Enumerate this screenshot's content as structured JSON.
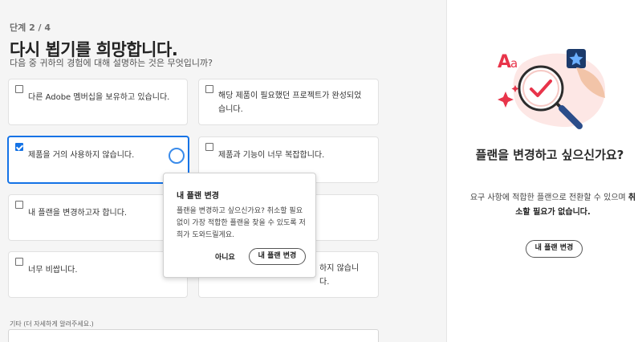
{
  "step": "단계 2 / 4",
  "title": "다시 뵙기를 희망합니다.",
  "subtitle": "다음 중 귀하의 경험에 대해 설명하는 것은 무엇입니까?",
  "options": [
    {
      "label": "다른 Adobe 멤버십을 보유하고 있습니다.",
      "checked": false
    },
    {
      "label": "해당 제품이 필요했던 프로젝트가 완성되었습니다.",
      "checked": false
    },
    {
      "label": "제품을 거의 사용하지 않습니다.",
      "checked": true
    },
    {
      "label": "제품과 기능이 너무 복잡합니다.",
      "checked": false
    },
    {
      "label": "내 플랜을 변경하고자 합니다.",
      "checked": false
    },
    {
      "label": "",
      "checked": false
    },
    {
      "label": "너무 비쌉니다.",
      "checked": false
    },
    {
      "label": "하지 않습니다.",
      "checked": false
    }
  ],
  "other": {
    "label": "기타 (더 자세하게 알려주세요.)",
    "value": ""
  },
  "popover": {
    "title": "내 플랜 변경",
    "body": "플랜을 변경하고 싶으신가요? 취소할 필요 없이 가장 적합한 플랜을 찾을 수 있도록 저희가 도와드릴게요.",
    "no_label": "아니요",
    "change_label": "내 플랜 변경"
  },
  "side": {
    "heading": "플랜을 변경하고 싶으신가요?",
    "desc_prefix": "요구 사항에 적합한 플랜으로 전환할 수 있으며 ",
    "desc_bold": "취소할 필요가 없습니다.",
    "button_label": "내 플랜 변경"
  },
  "icons": [
    "letter-aa-icon",
    "sparkle-icon",
    "star-badge-icon",
    "magnifier-check-icon"
  ],
  "colors": {
    "accent": "#1473e6",
    "illus_red": "#e8344a",
    "illus_navy": "#1b3a6b"
  }
}
